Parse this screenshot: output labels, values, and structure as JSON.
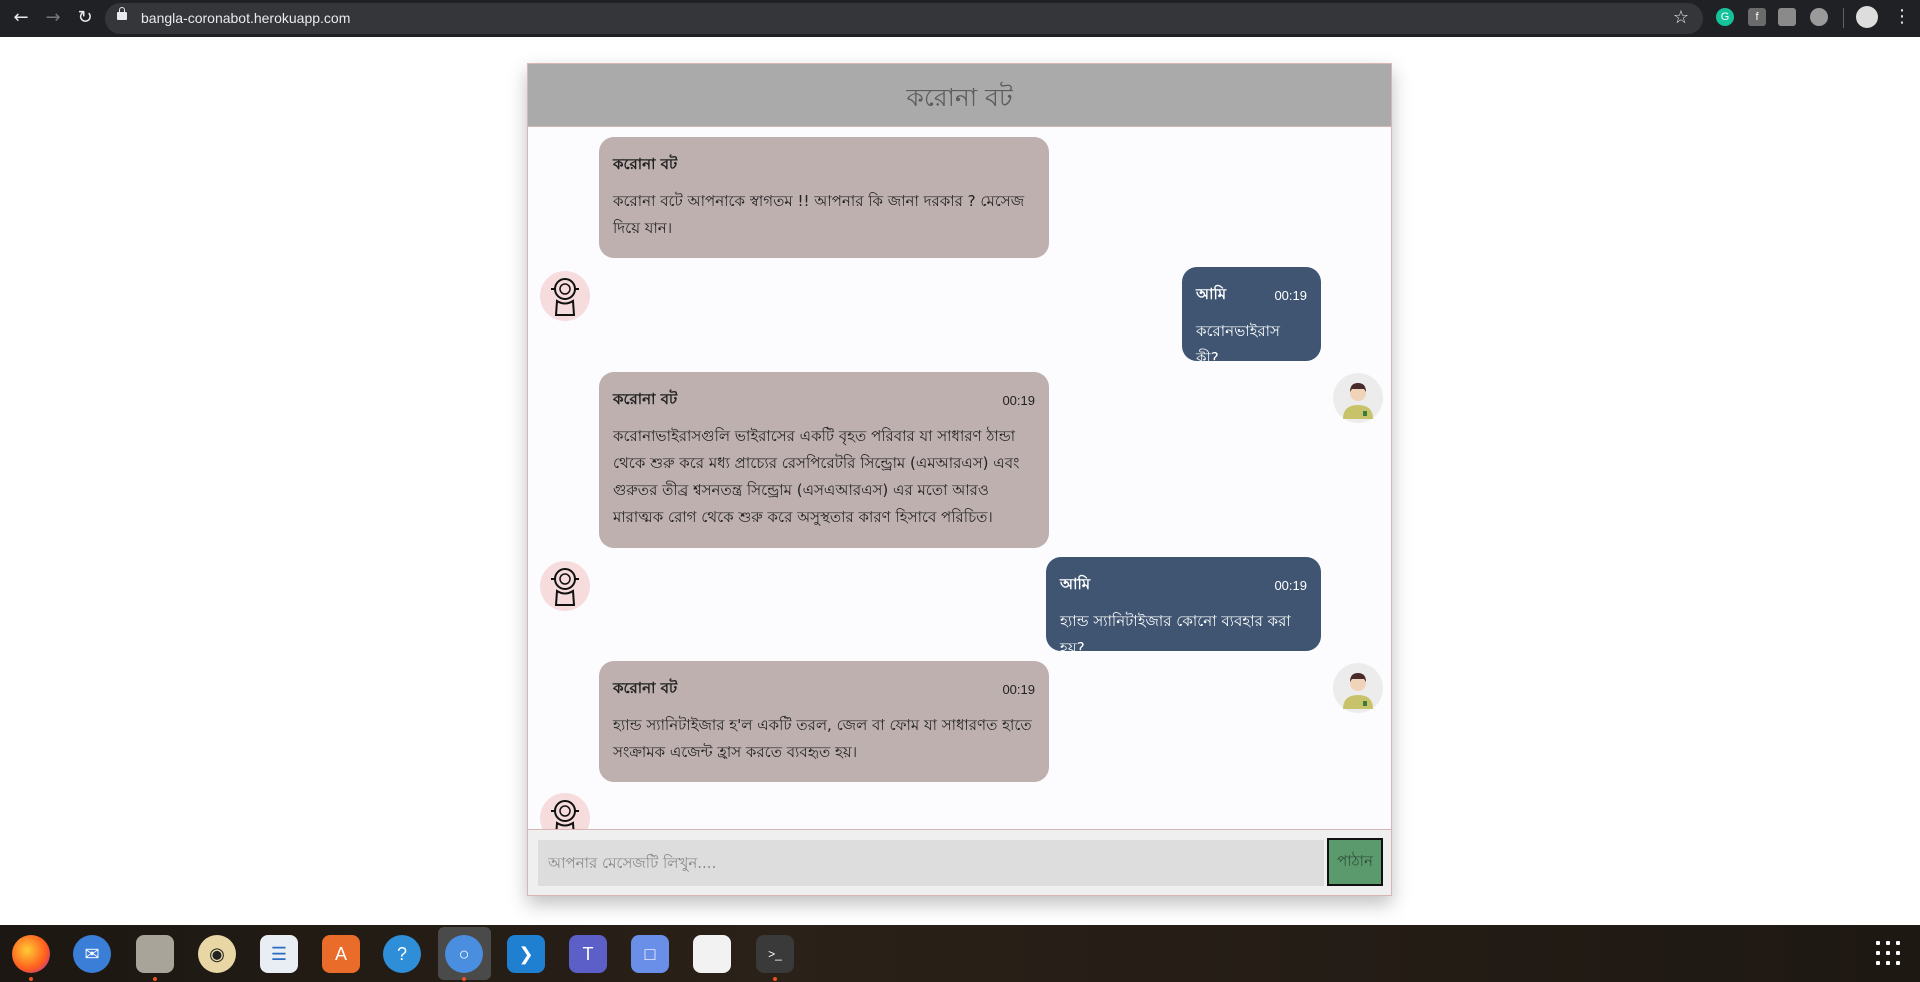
{
  "browser": {
    "url": "bangla-coronabot.herokuapp.com",
    "back_icon": "arrow-left",
    "forward_icon": "arrow-right",
    "reload_icon": "reload"
  },
  "chat": {
    "title": "করোনা বট",
    "messages": [
      {
        "sender": "bot",
        "name": "করোনা বট",
        "time": "",
        "text": "করোনা বটে আপনাকে স্বাগতম !! আপনার কি জানা দরকার ? মেসেজ দিয়ে যান।"
      },
      {
        "sender": "user",
        "name": "আমি",
        "time": "00:19",
        "text": "করোনভাইরাস কী?"
      },
      {
        "sender": "bot",
        "name": "করোনা বট",
        "time": "00:19",
        "text": "করোনাভাইরাসগুলি ভাইরাসের একটি বৃহত পরিবার যা সাধারণ ঠান্ডা থেকে শুরু করে মধ্য প্রাচ্যের রেসপিরেটরি সিন্ড্রোম (এমআরএস) এবং গুরুতর তীব্র শ্বসনতন্ত্র সিন্ড্রোম (এসএআরএস) এর মতো আরও মারাত্মক রোগ থেকে শুরু করে অসুস্থতার কারণ হিসাবে পরিচিত।"
      },
      {
        "sender": "user",
        "name": "আমি",
        "time": "00:19",
        "text": "হ্যান্ড স্যানিটাইজার কোনো ব্যবহার করা হয়?"
      },
      {
        "sender": "bot",
        "name": "করোনা বট",
        "time": "00:19",
        "text": "হ্যান্ড স্যানিটাইজার হ'ল একটি তরল, জেল বা ফোম যা সাধারণত হাতে সংক্রামক এজেন্ট হ্রাস করতে ব্যবহৃত হয়।"
      }
    ],
    "input_placeholder": "আপনার মেসেজটি লিখুন....",
    "send_label": "পাঠান"
  },
  "taskbar": {
    "apps": [
      "firefox",
      "thunderbird",
      "files",
      "rhythmbox",
      "libreoffice-writer",
      "software-center",
      "help",
      "chromium",
      "vscode",
      "teams",
      "screenshot",
      "text-editor",
      "terminal"
    ],
    "show_apps_icon": "grid"
  }
}
